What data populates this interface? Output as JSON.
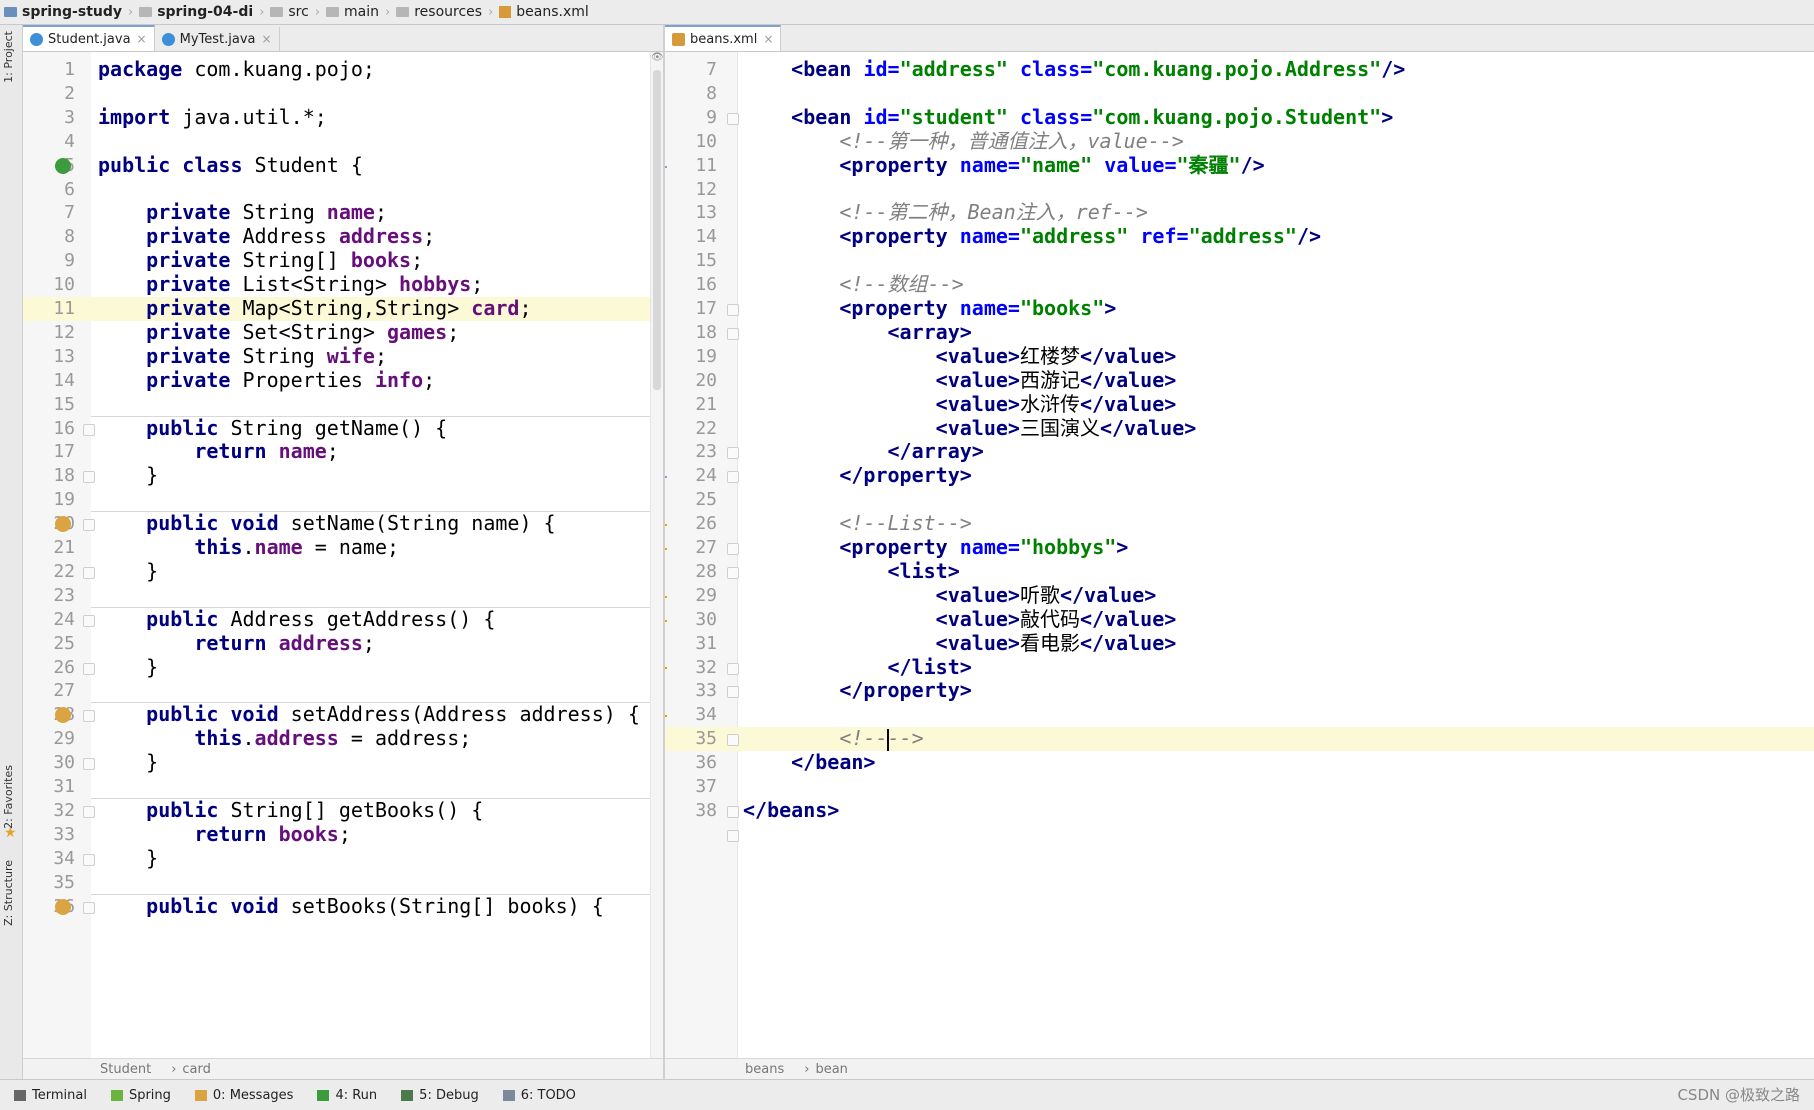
{
  "breadcrumbs": [
    {
      "label": "spring-study",
      "bold": true
    },
    {
      "label": "spring-04-di",
      "bold": true
    },
    {
      "label": "src"
    },
    {
      "label": "main"
    },
    {
      "label": "resources"
    },
    {
      "label": "beans.xml"
    }
  ],
  "left_strip": {
    "project_label": "1: Project",
    "favorites_label": "2: Favorites",
    "structure_label": "Z: Structure"
  },
  "left_pane": {
    "tabs": [
      {
        "label": "Student.java",
        "active": true
      },
      {
        "label": "MyTest.java",
        "active": false
      }
    ],
    "lines": [
      {
        "n": "1",
        "html": "<span class='kw'>package</span> com.kuang.pojo;"
      },
      {
        "n": "2",
        "html": ""
      },
      {
        "n": "3",
        "html": "<span class='kw'>import</span> java.util.*;"
      },
      {
        "n": "4",
        "html": ""
      },
      {
        "n": "5",
        "html": "<span class='kw'>public class</span> Student {"
      },
      {
        "n": "6",
        "html": ""
      },
      {
        "n": "7",
        "html": "    <span class='kw'>private</span> String <span class='fld'>name</span>;"
      },
      {
        "n": "8",
        "html": "    <span class='kw'>private</span> Address <span class='fld'>address</span>;"
      },
      {
        "n": "9",
        "html": "    <span class='kw'>private</span> String[] <span class='fld'>books</span>;"
      },
      {
        "n": "10",
        "html": "    <span class='kw'>private</span> List&lt;String&gt; <span class='fld'>hobbys</span>;"
      },
      {
        "n": "11",
        "html": "    <span class='kw'>private</span> Map&lt;String,String&gt; <span class='fld'>card</span>;",
        "highlight": true
      },
      {
        "n": "12",
        "html": "    <span class='kw'>private</span> Set&lt;String&gt; <span class='fld'>games</span>;"
      },
      {
        "n": "13",
        "html": "    <span class='kw'>private</span> String <span class='fld'>wife</span>;"
      },
      {
        "n": "14",
        "html": "    <span class='kw'>private</span> Properties <span class='fld'>info</span>;"
      },
      {
        "n": "15",
        "html": ""
      },
      {
        "n": "16",
        "html": "    <span class='kw'>public</span> String getName() {"
      },
      {
        "n": "17",
        "html": "        <span class='kw'>return</span> <span class='fld'>name</span>;"
      },
      {
        "n": "18",
        "html": "    }"
      },
      {
        "n": "19",
        "html": ""
      },
      {
        "n": "20",
        "html": "    <span class='kw'>public void</span> setName(String name) {"
      },
      {
        "n": "21",
        "html": "        <span class='kw'>this</span>.<span class='fld'>name</span> = name;"
      },
      {
        "n": "22",
        "html": "    }"
      },
      {
        "n": "23",
        "html": ""
      },
      {
        "n": "24",
        "html": "    <span class='kw'>public</span> Address getAddress() {"
      },
      {
        "n": "25",
        "html": "        <span class='kw'>return</span> <span class='fld'>address</span>;"
      },
      {
        "n": "26",
        "html": "    }"
      },
      {
        "n": "27",
        "html": ""
      },
      {
        "n": "28",
        "html": "    <span class='kw'>public void</span> setAddress(Address address) {"
      },
      {
        "n": "29",
        "html": "        <span class='kw'>this</span>.<span class='fld'>address</span> = address;"
      },
      {
        "n": "30",
        "html": "    }"
      },
      {
        "n": "31",
        "html": ""
      },
      {
        "n": "32",
        "html": "    <span class='kw'>public</span> String[] getBooks() {"
      },
      {
        "n": "33",
        "html": "        <span class='kw'>return</span> <span class='fld'>books</span>;"
      },
      {
        "n": "34",
        "html": "    }"
      },
      {
        "n": "35",
        "html": ""
      },
      {
        "n": "36",
        "html": "    <span class='kw'>public void</span> setBooks(String[] books) {"
      }
    ],
    "status_path": [
      "Student",
      "card"
    ]
  },
  "right_pane": {
    "tabs": [
      {
        "label": "beans.xml",
        "active": true
      }
    ],
    "lines": [
      {
        "n": "7",
        "html": "    <span class='tag'>&lt;bean</span> <span class='attr'>id=</span><span class='str'>\"address\"</span> <span class='attr'>class=</span><span class='str'>\"com.kuang.pojo.Address\"</span><span class='tag'>/&gt;</span>"
      },
      {
        "n": "8",
        "html": ""
      },
      {
        "n": "9",
        "html": "    <span class='tag'>&lt;bean</span> <span class='attr'>id=</span><span class='str'>\"student\"</span> <span class='attr'>class=</span><span class='str'>\"com.kuang.pojo.Student\"</span><span class='tag'>&gt;</span>"
      },
      {
        "n": "10",
        "html": "        <span class='cmt'>&lt;!--第一种，普通值注入，value--&gt;</span>"
      },
      {
        "n": "11",
        "html": "        <span class='tag'>&lt;property</span> <span class='attr'>name=</span><span class='str'>\"name\"</span> <span class='attr'>value=</span><span class='str'>\"秦疆\"</span><span class='tag'>/&gt;</span>"
      },
      {
        "n": "12",
        "html": ""
      },
      {
        "n": "13",
        "html": "        <span class='cmt'>&lt;!--第二种，Bean注入，ref--&gt;</span>"
      },
      {
        "n": "14",
        "html": "        <span class='tag'>&lt;property</span> <span class='attr'>name=</span><span class='str'>\"address\"</span> <span class='attr'>ref=</span><span class='str'>\"address\"</span><span class='tag'>/&gt;</span>"
      },
      {
        "n": "15",
        "html": ""
      },
      {
        "n": "16",
        "html": "        <span class='cmt'>&lt;!--数组--&gt;</span>"
      },
      {
        "n": "17",
        "html": "        <span class='tag'>&lt;property</span> <span class='attr'>name=</span><span class='str'>\"books\"</span><span class='tag'>&gt;</span>"
      },
      {
        "n": "18",
        "html": "            <span class='tag'>&lt;array&gt;</span>"
      },
      {
        "n": "19",
        "html": "                <span class='tag'>&lt;value&gt;</span>红楼梦<span class='tag'>&lt;/value&gt;</span>"
      },
      {
        "n": "20",
        "html": "                <span class='tag'>&lt;value&gt;</span>西游记<span class='tag'>&lt;/value&gt;</span>"
      },
      {
        "n": "21",
        "html": "                <span class='tag'>&lt;value&gt;</span>水浒传<span class='tag'>&lt;/value&gt;</span>"
      },
      {
        "n": "22",
        "html": "                <span class='tag'>&lt;value&gt;</span>三国演义<span class='tag'>&lt;/value&gt;</span>"
      },
      {
        "n": "23",
        "html": "            <span class='tag'>&lt;/array&gt;</span>"
      },
      {
        "n": "24",
        "html": "        <span class='tag'>&lt;/property&gt;</span>"
      },
      {
        "n": "25",
        "html": ""
      },
      {
        "n": "26",
        "html": "        <span class='cmt'>&lt;!--List--&gt;</span>"
      },
      {
        "n": "27",
        "html": "        <span class='tag'>&lt;property</span> <span class='attr'>name=</span><span class='str'>\"hobbys\"</span><span class='tag'>&gt;</span>"
      },
      {
        "n": "28",
        "html": "            <span class='tag'>&lt;list&gt;</span>"
      },
      {
        "n": "29",
        "html": "                <span class='tag'>&lt;value&gt;</span>听歌<span class='tag'>&lt;/value&gt;</span>"
      },
      {
        "n": "30",
        "html": "                <span class='tag'>&lt;value&gt;</span>敲代码<span class='tag'>&lt;/value&gt;</span>"
      },
      {
        "n": "31",
        "html": "                <span class='tag'>&lt;value&gt;</span>看电影<span class='tag'>&lt;/value&gt;</span>"
      },
      {
        "n": "32",
        "html": "            <span class='tag'>&lt;/list&gt;</span>"
      },
      {
        "n": "33",
        "html": "        <span class='tag'>&lt;/property&gt;</span>"
      },
      {
        "n": "34",
        "html": ""
      },
      {
        "n": "35",
        "html": "        <span class='cmt'>&lt;!--<span class='cursor'></span>--&gt;</span>",
        "highlight": true
      },
      {
        "n": "36",
        "html": "    <span class='tag'>&lt;/bean&gt;</span>"
      },
      {
        "n": "37",
        "html": ""
      },
      {
        "n": "38",
        "html": "<span class='tag'>&lt;/beans&gt;</span>"
      }
    ],
    "status_path": [
      "beans",
      "bean"
    ]
  },
  "tool_windows": [
    {
      "label": "Terminal",
      "color": "#666666"
    },
    {
      "label": "Spring",
      "color": "#6db33f"
    },
    {
      "label": "0: Messages",
      "color": "#d9a441"
    },
    {
      "label": "4: Run",
      "color": "#3c9b3c"
    },
    {
      "label": "5: Debug",
      "color": "#4c7a4c"
    },
    {
      "label": "6: TODO",
      "color": "#7a8a9a"
    }
  ],
  "watermark": "CSDN @极致之路"
}
